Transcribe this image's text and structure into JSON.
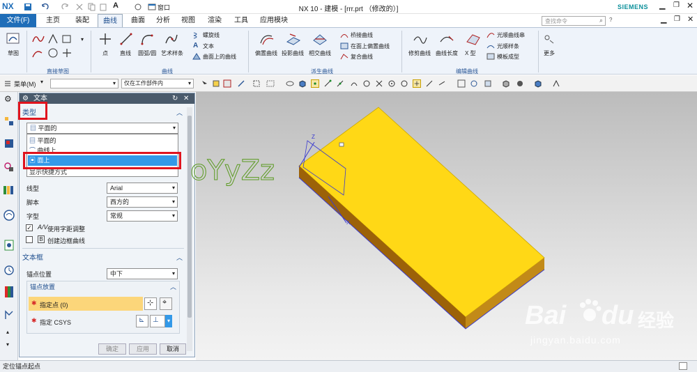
{
  "title_bar": {
    "logo": "NX",
    "window_menu": "窗口",
    "title": "NX 10 - 建模 - [rrr.prt （修改的）]",
    "brand": "SIEMENS"
  },
  "menubar": {
    "file": "文件(F)",
    "tabs": [
      "主页",
      "装配",
      "曲线",
      "曲面",
      "分析",
      "视图",
      "渲染",
      "工具",
      "应用模块"
    ],
    "active_tab": "曲线",
    "search_placeholder": "查找命令"
  },
  "ribbon": {
    "sketch": "草图",
    "point": "点",
    "line": "直线",
    "arc": "圆弧/圆",
    "studio_spline": "艺术样条",
    "helix": "螺旋线",
    "text": "文本",
    "curve_on_surface": "曲面上的曲线",
    "offset_curve": "偏置曲线",
    "project_curve": "投影曲线",
    "intersect_curve": "相交曲线",
    "bridge_curve": "桥接曲线",
    "offset_in_face": "在面上偏置曲线",
    "composite_curve": "复合曲线",
    "fix_curve": "修剪曲线",
    "curve_length": "曲线长度",
    "x_form": "X 型",
    "smooth_string": "光顺曲线串",
    "smooth_spline": "光顺样条",
    "template_shape": "模板成型",
    "more": "更多",
    "groups": [
      "直接草图",
      "曲线",
      "派生曲线",
      "编辑曲线"
    ]
  },
  "toolbar": {
    "menu": "菜单(M)",
    "filter_value": "",
    "scope_value": "仅在工作部件内"
  },
  "dialog": {
    "title": "文本",
    "type_section": "类型",
    "type_value": "平面的",
    "type_options": [
      "平面的",
      "曲线上",
      "面上",
      "显示快捷方式"
    ],
    "selected_option": "面上",
    "font_label": "线型",
    "font_value": "Arial",
    "script_label": "脚本",
    "script_value": "西方的",
    "style_label": "字型",
    "style_value": "常规",
    "kerning_label": "使用字距调整",
    "box_curve_label": "创建边框曲线",
    "frame_section": "文本框",
    "anchor_label": "锚点位置",
    "anchor_value": "中下",
    "anchor_place_section": "锚点放置",
    "specify_point": "指定点 (0)",
    "specify_csys": "指定 CSYS",
    "ok": "确定",
    "apply": "应用",
    "cancel": "取消"
  },
  "graphics": {
    "preview_text": "oYyZz",
    "axis_z": "Z",
    "axis_x": "X"
  },
  "status": {
    "text": "定位锚点起点"
  },
  "watermark": {
    "brand": "Bai",
    "brand_du": "du",
    "cn": "经验",
    "url": "jingyan.baidu.com"
  },
  "colors": {
    "accent": "#1f6db8",
    "block_top": "#ffd816",
    "block_side": "#a66a0a",
    "preview_text": "#8fd33a",
    "highlight": "#e0141e"
  }
}
